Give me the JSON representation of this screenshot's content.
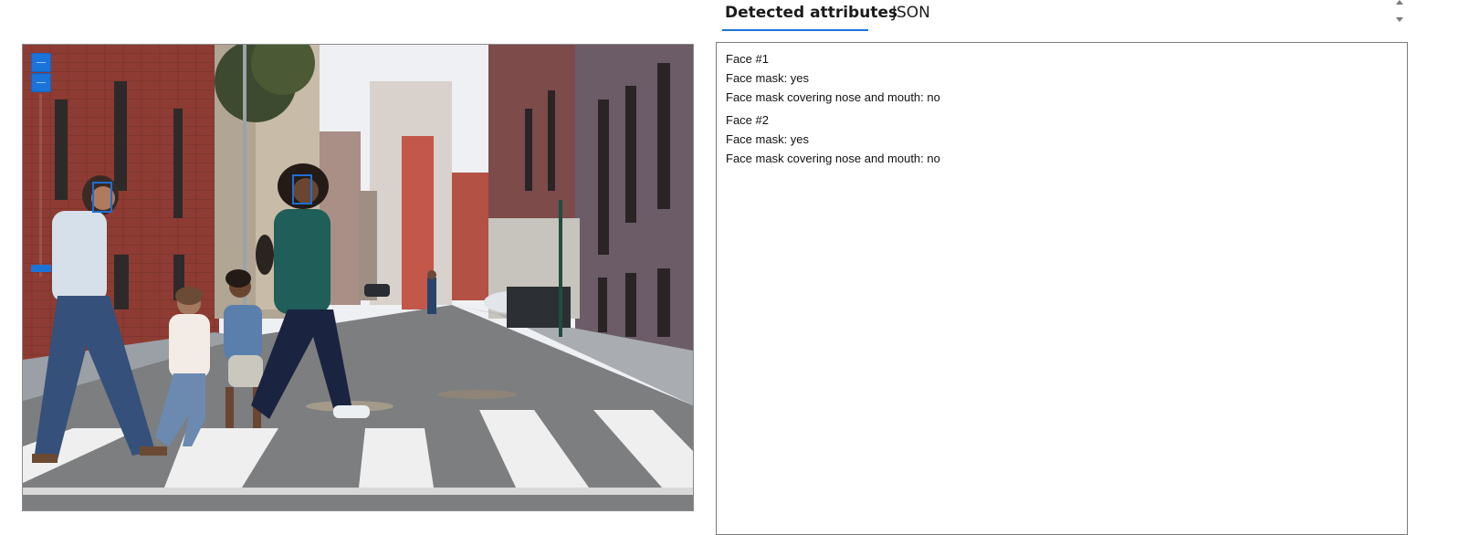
{
  "tabs": [
    {
      "label": "Detected attributes",
      "selected": true
    },
    {
      "label": "JSON",
      "selected": false
    }
  ],
  "viewer": {
    "image_description": "street-crosswalk-family-photo",
    "detected_face_count": 2
  },
  "results": {
    "faces": [
      {
        "heading": "Face #1",
        "mask": "Face mask: yes",
        "cover": "Face mask covering nose and mouth: no"
      },
      {
        "heading": "Face #2",
        "mask": "Face mask: yes",
        "cover": "Face mask covering nose and mouth: no"
      }
    ]
  },
  "colors": {
    "accent": "#1a73d9",
    "face_box": "#1e6fd6",
    "border": "#7a7a7a"
  },
  "icons": [
    "zoom-in-icon",
    "zoom-out-icon",
    "scroll-up-icon",
    "scroll-down-icon"
  ]
}
